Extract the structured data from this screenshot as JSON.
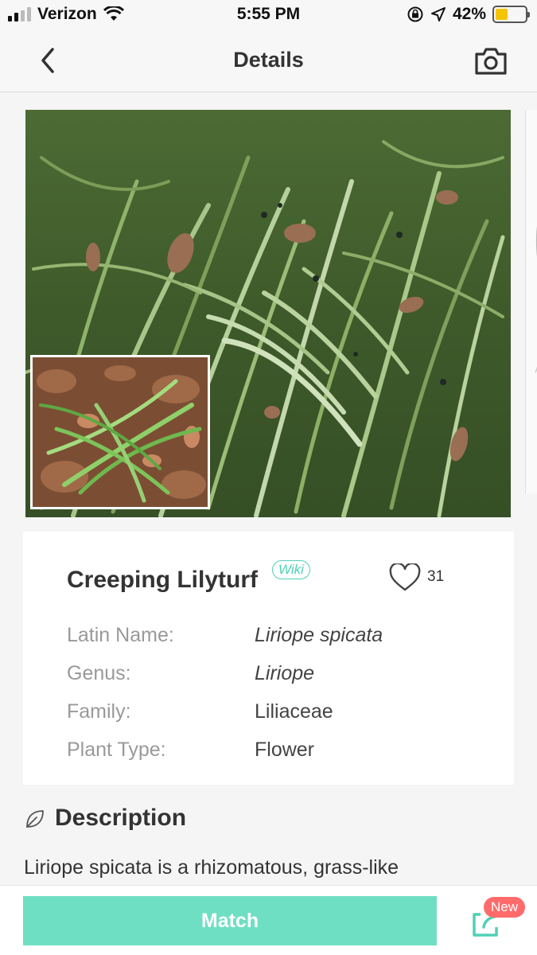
{
  "status_bar": {
    "carrier": "Verizon",
    "time": "5:55 PM",
    "battery": "42%",
    "battery_level": 0.42
  },
  "nav": {
    "title": "Details",
    "back_icon": "chevron-left-icon",
    "camera_icon": "camera-icon"
  },
  "plant": {
    "name": "Creeping Lilyturf",
    "wiki_label": "Wiki",
    "likes": "31",
    "attributes": [
      {
        "label": "Latin Name:",
        "value": "Liriope spicata"
      },
      {
        "label": "Genus:",
        "value": "Liriope"
      },
      {
        "label": "Family:",
        "value": "Liliaceae"
      },
      {
        "label": "Plant Type:",
        "value": "Flower"
      }
    ]
  },
  "description": {
    "heading": "Description",
    "text": "Liriope spicata is a rhizomatous, grass-like"
  },
  "bottom": {
    "match_label": "Match",
    "new_badge": "New"
  },
  "colors": {
    "accent": "#6fdfc4",
    "wiki": "#4fd1b5",
    "badge": "#ff6b6b",
    "battery": "#f5c400"
  }
}
